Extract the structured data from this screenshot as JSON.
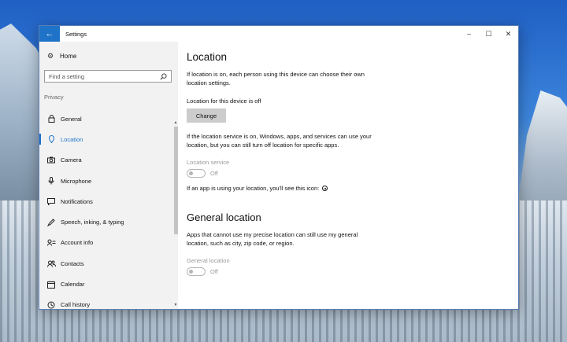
{
  "window": {
    "title": "Settings",
    "back_icon": "arrow-left-icon",
    "controls": [
      "minimize-icon",
      "maximize-icon",
      "close-icon"
    ],
    "accent": "#1e72c8"
  },
  "sidebar": {
    "home_label": "Home",
    "search_placeholder": "Find a setting",
    "section_label": "Privacy",
    "items": [
      {
        "label": "General",
        "icon": "lock-icon"
      },
      {
        "label": "Location",
        "icon": "location-icon",
        "active": true
      },
      {
        "label": "Camera",
        "icon": "camera-icon"
      },
      {
        "label": "Microphone",
        "icon": "microphone-icon"
      },
      {
        "label": "Notifications",
        "icon": "notifications-icon"
      },
      {
        "label": "Speech, inking, & typing",
        "icon": "speech-icon"
      },
      {
        "label": "Account info",
        "icon": "account-info-icon"
      },
      {
        "label": "Contacts",
        "icon": "contacts-icon"
      },
      {
        "label": "Calendar",
        "icon": "calendar-icon"
      },
      {
        "label": "Call history",
        "icon": "call-history-icon"
      }
    ]
  },
  "main": {
    "title": "Location",
    "intro": "If location is on, each person using this device can choose their own location settings.",
    "device_status": "Location for this device is off",
    "change_label": "Change",
    "service_desc": "If the location service is on, Windows, apps, and services can use your location, but you can still turn off location for specific apps.",
    "service_label": "Location service",
    "service_state": "Off",
    "icon_note": "If an app is using your location, you'll see this icon:",
    "general_title": "General location",
    "general_desc": "Apps that cannot use my precise location can still use my general location, such as city, zip code, or region.",
    "general_label": "General location",
    "general_state": "Off"
  }
}
